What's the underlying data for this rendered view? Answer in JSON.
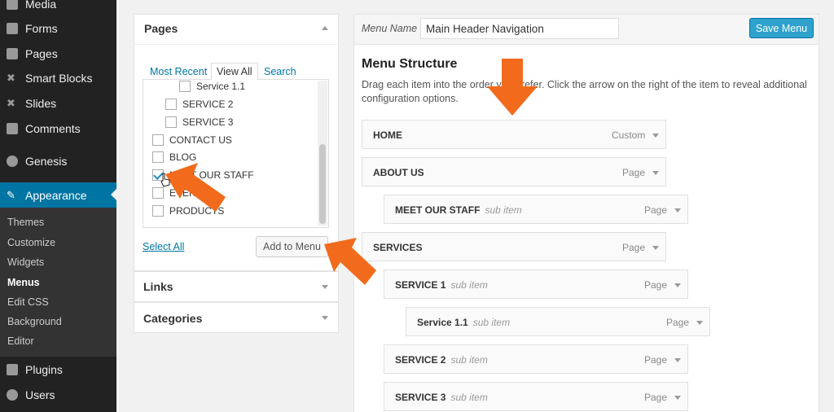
{
  "sidebar": {
    "items": [
      {
        "label": "Media",
        "icon": "media-icon"
      },
      {
        "label": "Forms",
        "icon": "forms-icon"
      },
      {
        "label": "Pages",
        "icon": "pages-icon"
      },
      {
        "label": "Smart Blocks",
        "icon": "pin-icon"
      },
      {
        "label": "Slides",
        "icon": "pin-icon"
      },
      {
        "label": "Comments",
        "icon": "comments-icon"
      },
      {
        "label": "Genesis",
        "icon": "genesis-icon"
      },
      {
        "label": "Appearance",
        "icon": "appearance-icon"
      },
      {
        "label": "Plugins",
        "icon": "plugins-icon"
      },
      {
        "label": "Users",
        "icon": "users-icon"
      }
    ],
    "appearance_submenu": [
      "Themes",
      "Customize",
      "Widgets",
      "Menus",
      "Edit CSS",
      "Background",
      "Editor"
    ],
    "current_submenu": "Menus",
    "accent_color": "#0074a2"
  },
  "pages_panel": {
    "title": "Pages",
    "tabs": [
      "Most Recent",
      "View All",
      "Search"
    ],
    "active_tab": "View All",
    "items": [
      {
        "label": "Service 1.1",
        "checked": false,
        "level": 2
      },
      {
        "label": "SERVICE 2",
        "checked": false,
        "level": 1
      },
      {
        "label": "SERVICE 3",
        "checked": false,
        "level": 1
      },
      {
        "label": "CONTACT US",
        "checked": false,
        "level": 0
      },
      {
        "label": "BLOG",
        "checked": false,
        "level": 0
      },
      {
        "label": "MEET OUR STAFF",
        "checked": true,
        "level": 0
      },
      {
        "label": "EVENTS",
        "checked": false,
        "level": 0
      },
      {
        "label": "PRODUCTS",
        "checked": false,
        "level": 0
      }
    ],
    "select_all": "Select All",
    "add_button": "Add to Menu"
  },
  "links_panel": {
    "title": "Links"
  },
  "categories_panel": {
    "title": "Categories"
  },
  "menu": {
    "name_label": "Menu Name",
    "name_value": "Main Header Navigation",
    "save_button": "Save Menu",
    "structure_title": "Menu Structure",
    "structure_desc": "Drag each item into the order you prefer. Click the arrow on the right of the item to reveal additional configuration options.",
    "items": [
      {
        "title": "HOME",
        "sub": "",
        "type": "Custom"
      },
      {
        "title": "ABOUT US",
        "sub": "",
        "type": "Page"
      },
      {
        "title": "MEET OUR STAFF",
        "sub": "sub item",
        "type": "Page"
      },
      {
        "title": "SERVICES",
        "sub": "",
        "type": "Page"
      },
      {
        "title": "SERVICE 1",
        "sub": "sub item",
        "type": "Page"
      },
      {
        "title": "Service 1.1",
        "sub": "sub item",
        "type": "Page"
      },
      {
        "title": "SERVICE 2",
        "sub": "sub item",
        "type": "Page"
      },
      {
        "title": "SERVICE 3",
        "sub": "sub item",
        "type": "Page"
      }
    ]
  },
  "annotation_color": "#f26b1d"
}
